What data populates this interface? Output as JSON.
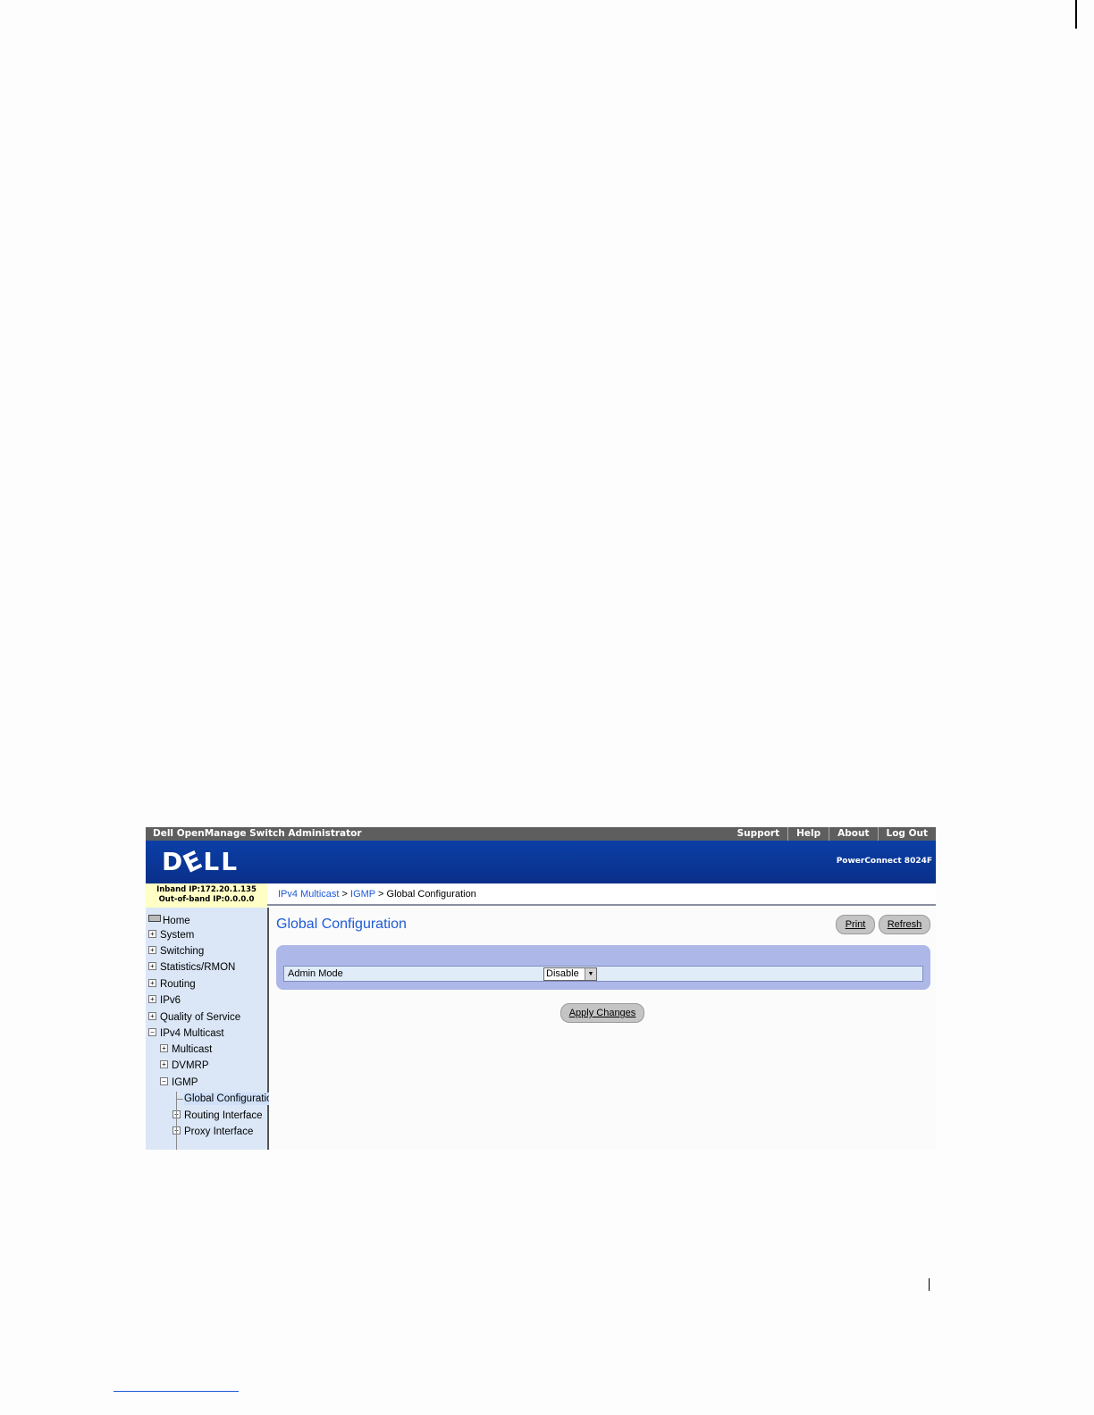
{
  "header": {
    "app_title": "Dell OpenManage Switch Administrator",
    "links": [
      "Support",
      "Help",
      "About",
      "Log Out"
    ],
    "logo": "DELL",
    "product": "PowerConnect 8024F"
  },
  "ip_info": {
    "inband": "Inband IP:172.20.1.135",
    "outofband": "Out-of-band IP:0.0.0.0"
  },
  "breadcrumb": {
    "items": [
      "IPv4 Multicast",
      "IGMP",
      "Global Configuration"
    ],
    "separator": ">"
  },
  "nav": {
    "home": "Home",
    "items": [
      "System",
      "Switching",
      "Statistics/RMON",
      "Routing",
      "IPv6",
      "Quality of Service",
      "IPv4 Multicast"
    ],
    "ipv4_children": [
      "Multicast",
      "DVMRP",
      "IGMP"
    ],
    "igmp_children": [
      "Global Configuration",
      "Routing Interface",
      "Proxy Interface"
    ],
    "expand_glyph": "+",
    "collapse_glyph": "−"
  },
  "page": {
    "title": "Global Configuration",
    "print_label": "Print",
    "refresh_label": "Refresh",
    "admin_mode_label": "Admin Mode",
    "admin_mode_value": "Disable",
    "apply_label": "Apply Changes"
  },
  "colors": {
    "banner": "#0b3fa6",
    "accent_link": "#1e5bd8",
    "nav_bg": "#dbe7f7",
    "panel": "#aeb8e8"
  }
}
